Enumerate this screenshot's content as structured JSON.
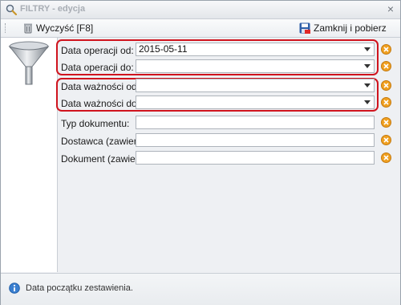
{
  "window": {
    "title": "FILTRY - edycja",
    "close_glyph": "×"
  },
  "toolbar": {
    "clear_label": "Wyczyść [F8]",
    "close_label": "Zamknij i pobierz"
  },
  "fields": [
    {
      "label": "Data operacji od:",
      "value": "2015-05-11",
      "type": "date"
    },
    {
      "label": "Data operacji do:",
      "value": "",
      "type": "date"
    },
    {
      "label": "Data ważności od:",
      "value": "",
      "type": "date"
    },
    {
      "label": "Data ważności do:",
      "value": "",
      "type": "date"
    },
    {
      "label": "Typ dokumentu:",
      "value": "",
      "type": "text"
    },
    {
      "label": "Dostawca (zawiera):",
      "value": "",
      "type": "text"
    },
    {
      "label": "Dokument (zawiera):",
      "value": "",
      "type": "text"
    }
  ],
  "status": {
    "text": "Data początku zestawienia."
  },
  "colors": {
    "highlight": "#d0141e",
    "clear_icon": "#f0a020",
    "info_icon": "#3a7fd0"
  },
  "icons": {
    "title": "magnifier-icon",
    "clear": "trash-icon",
    "close": "save-icon",
    "panel": "funnel-icon",
    "field_clear": "clear-icon",
    "status": "info-icon"
  }
}
